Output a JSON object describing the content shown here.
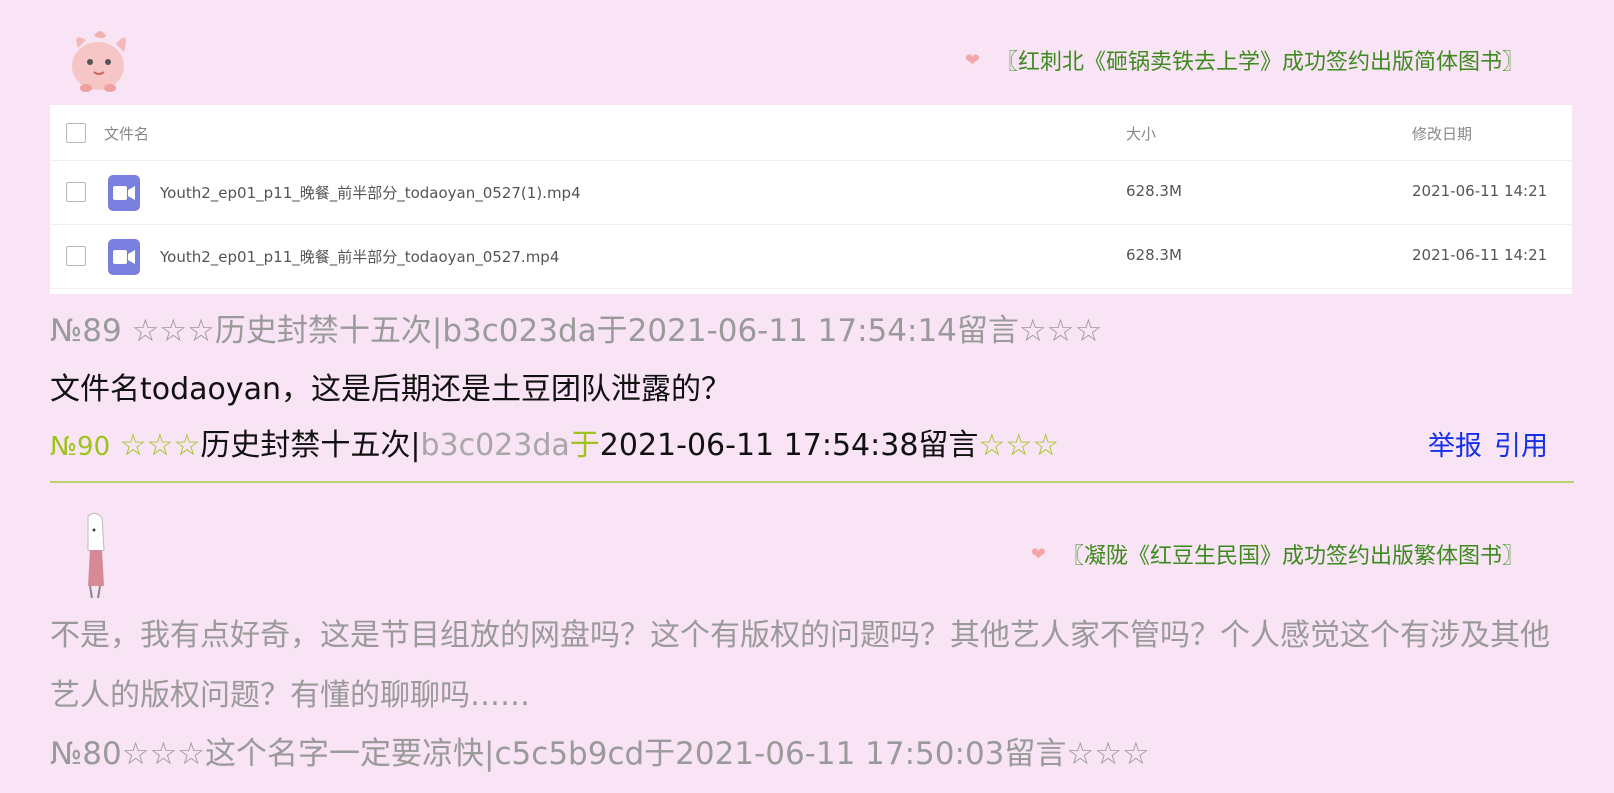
{
  "post1": {
    "signature": "〖红刺北《砸锅卖铁去上学》成功签约出版简体图书〗",
    "heart_icon": "heart-icon"
  },
  "file_table": {
    "headers": {
      "name": "文件名",
      "size": "大小",
      "date": "修改日期"
    },
    "rows": [
      {
        "name": "Youth2_ep01_p11_晚餐_前半部分_todaoyan_0527(1).mp4",
        "size": "628.3M",
        "date": "2021-06-11 14:21"
      },
      {
        "name": "Youth2_ep01_p11_晚餐_前半部分_todaoyan_0527.mp4",
        "size": "628.3M",
        "date": "2021-06-11 14:21"
      }
    ]
  },
  "comment89": {
    "text": "№89 ☆☆☆历史封禁十五次|b3c023da于2021-06-11 17:54:14留言☆☆☆"
  },
  "question": "文件名todaoyan，这是后期还是土豆团队泄露的？",
  "comment90": {
    "number": "№90",
    "stars_left": " ☆☆☆",
    "author": "历史封禁十五次",
    "sep": "|",
    "user_id": "b3c023da",
    "yu": "于",
    "timestamp": "2021-06-11 17:54:38留言",
    "stars_right": "☆☆☆",
    "report": "举报",
    "quote": "引用"
  },
  "post2": {
    "signature": "〖凝陇《红豆生民国》成功签约出版繁体图书〗",
    "body": "不是，我有点好奇，这是节目组放的网盘吗？这个有版权的问题吗？其他艺人家不管吗？个人感觉这个有涉及其他艺人的版权问题？有懂的聊聊吗……"
  },
  "comment80": {
    "text": "№80☆☆☆这个名字一定要凉快|c5c5b9cd于2021-06-11 17:50:03留言☆☆☆"
  },
  "colors": {
    "background": "#f8e4f4",
    "signature": "#3d8a1e",
    "accent_green": "#9dc41c",
    "link": "#1530e8",
    "file_icon": "#7b7fe0"
  }
}
